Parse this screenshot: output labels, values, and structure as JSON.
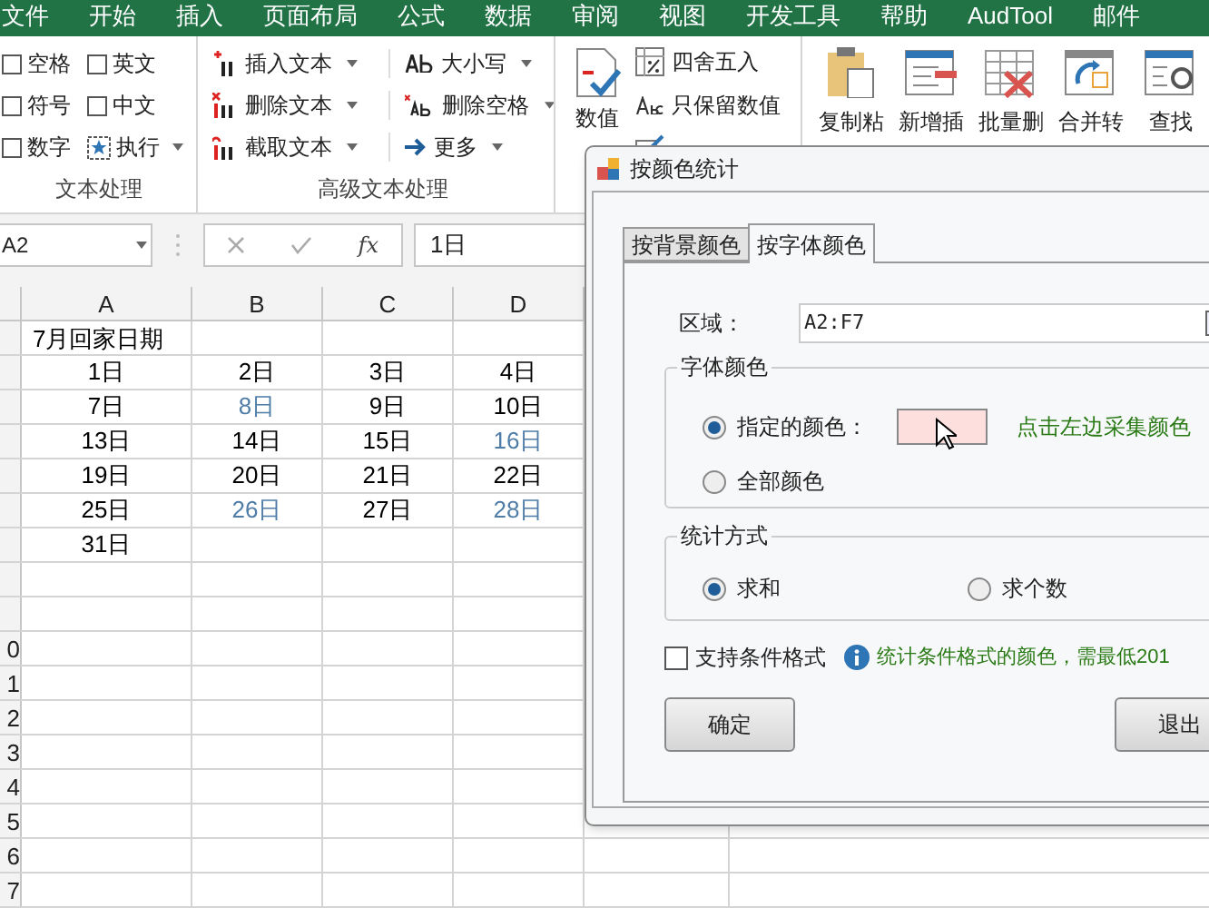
{
  "menu_tabs": [
    "文件",
    "开始",
    "插入",
    "页面布局",
    "公式",
    "数据",
    "审阅",
    "视图",
    "开发工具",
    "帮助",
    "AudTool",
    "邮件"
  ],
  "ribbon": {
    "text_group": {
      "label": "文本处理",
      "checkboxes": [
        {
          "label": "空格",
          "checked": false
        },
        {
          "label": "英文",
          "checked": false
        },
        {
          "label": "符号",
          "checked": false
        },
        {
          "label": "中文",
          "checked": false
        },
        {
          "label": "数字",
          "checked": false
        }
      ],
      "run_button": "执行"
    },
    "advanced_group": {
      "label": "高级文本处理",
      "buttons": [
        {
          "kind": "insert",
          "label": "插入文本"
        },
        {
          "kind": "case",
          "label": "大小写"
        },
        {
          "kind": "delete",
          "label": "删除文本"
        },
        {
          "kind": "trim",
          "label": "删除空格"
        },
        {
          "kind": "cut",
          "label": "截取文本"
        },
        {
          "kind": "more",
          "label": "更多"
        }
      ]
    },
    "number_group": {
      "large_button": "数值",
      "buttons": [
        {
          "kind": "round",
          "label": "四舍五入"
        },
        {
          "kind": "abc",
          "label": "只保留数值"
        }
      ]
    },
    "tools": [
      {
        "kind": "paste",
        "label": "复制粘"
      },
      {
        "kind": "insert",
        "label": "新增插"
      },
      {
        "kind": "delete",
        "label": "批量删"
      },
      {
        "kind": "merge",
        "label": "合并转"
      },
      {
        "kind": "find",
        "label": "查找"
      }
    ]
  },
  "formula_bar": {
    "name_box": "A2",
    "function_label": "fx",
    "formula": "1日"
  },
  "sheet": {
    "columns": [
      "A",
      "B",
      "C",
      "D"
    ],
    "rows": [
      {
        "cells": [
          {
            "text": "7月回家日期",
            "color": "#000000"
          }
        ]
      },
      {
        "cells": [
          {
            "text": "1日",
            "color": "#000000"
          },
          {
            "text": "2日",
            "color": "#000000"
          },
          {
            "text": "3日",
            "color": "#000000"
          },
          {
            "text": "4日",
            "color": "#000000"
          }
        ]
      },
      {
        "cells": [
          {
            "text": "7日",
            "color": "#000000"
          },
          {
            "text": "8日",
            "color": "#4f7da8"
          },
          {
            "text": "9日",
            "color": "#000000"
          },
          {
            "text": "10日",
            "color": "#000000"
          }
        ]
      },
      {
        "cells": [
          {
            "text": "13日",
            "color": "#000000"
          },
          {
            "text": "14日",
            "color": "#000000"
          },
          {
            "text": "15日",
            "color": "#000000"
          },
          {
            "text": "16日",
            "color": "#4f7da8"
          }
        ]
      },
      {
        "cells": [
          {
            "text": "19日",
            "color": "#000000"
          },
          {
            "text": "20日",
            "color": "#000000"
          },
          {
            "text": "21日",
            "color": "#000000"
          },
          {
            "text": "22日",
            "color": "#000000"
          }
        ]
      },
      {
        "cells": [
          {
            "text": "25日",
            "color": "#000000"
          },
          {
            "text": "26日",
            "color": "#4f7da8"
          },
          {
            "text": "27日",
            "color": "#000000"
          },
          {
            "text": "28日",
            "color": "#4f7da8"
          }
        ]
      },
      {
        "cells": [
          {
            "text": "31日",
            "color": "#000000"
          }
        ]
      }
    ],
    "row_numbers_below": [
      "0",
      "1",
      "2",
      "3",
      "4",
      "5",
      "6",
      "7"
    ]
  },
  "dialog": {
    "title": "按颜色统计",
    "tabs": [
      {
        "label": "按背景颜色",
        "selected": false
      },
      {
        "label": "按字体颜色",
        "selected": true
      }
    ],
    "range": {
      "label": "区域：",
      "value": "A2:F7"
    },
    "font_color_group": {
      "title": "字体颜色",
      "options": [
        {
          "label": "指定的颜色：",
          "selected": true
        },
        {
          "label": "全部颜色",
          "selected": false
        }
      ],
      "hint": "点击左边采集颜色"
    },
    "method_group": {
      "title": "统计方式",
      "options": [
        {
          "label": "求和",
          "selected": true
        },
        {
          "label": "求个数",
          "selected": false
        }
      ]
    },
    "conditional": {
      "label": "支持条件格式",
      "checked": false,
      "note": "统计条件格式的颜色，需最低201"
    },
    "buttons": [
      "确定",
      "退出"
    ]
  }
}
